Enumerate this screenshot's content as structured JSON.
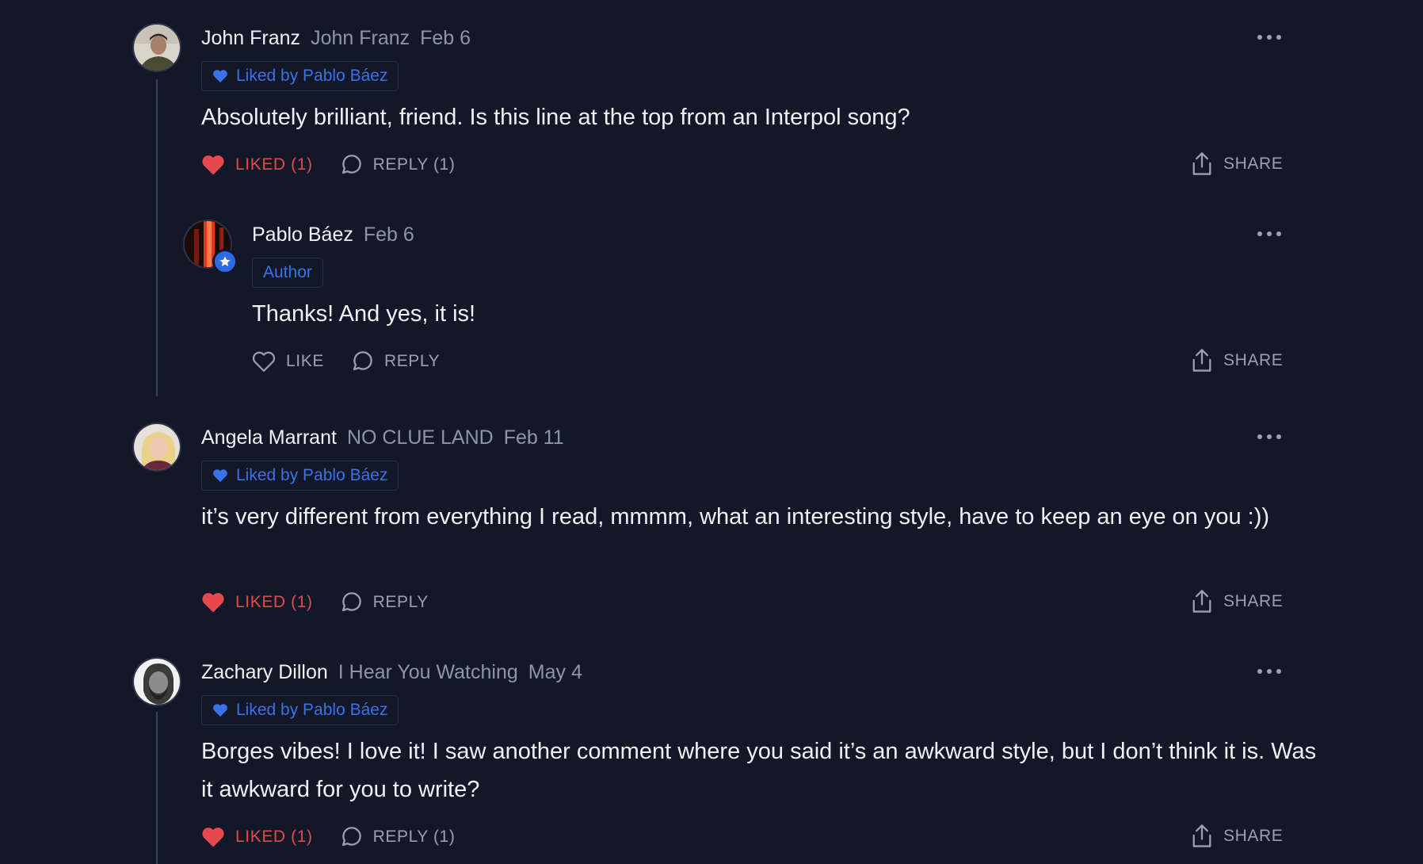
{
  "comments": [
    {
      "name": "John Franz",
      "publication": "John Franz",
      "date": "Feb 6",
      "badge": "Liked by Pablo Báez",
      "text": "Absolutely brilliant, friend. Is this line at the top from an Interpol song?",
      "like_label": "LIKED (1)",
      "reply_label": "REPLY (1)",
      "share_label": "SHARE",
      "liked": true
    },
    {
      "name": "Pablo Báez",
      "date": "Feb 6",
      "badge": "Author",
      "text": "Thanks! And yes, it is!",
      "like_label": "LIKE",
      "reply_label": "REPLY",
      "share_label": "SHARE",
      "liked": false
    },
    {
      "name": "Angela Marrant",
      "publication": "NO CLUE LAND",
      "date": "Feb 11",
      "badge": "Liked by Pablo Báez",
      "text": "it’s very different from everything I read, mmmm, what an interesting style, have to keep an eye on you :))",
      "like_label": "LIKED (1)",
      "reply_label": "REPLY",
      "share_label": "SHARE",
      "liked": true
    },
    {
      "name": "Zachary Dillon",
      "publication": "I Hear You Watching",
      "date": "May 4",
      "badge": "Liked by Pablo Báez",
      "text": "Borges vibes! I love it! I saw another comment where you said it’s an awkward style, but I don’t think it is. Was it awkward for you to write?",
      "like_label": "LIKED (1)",
      "reply_label": "REPLY (1)",
      "share_label": "SHARE",
      "liked": true
    }
  ],
  "colors": {
    "background": "#121827",
    "accent_blue": "#3a72e8",
    "liked_red": "#e5484d",
    "muted": "#9aa1ad"
  },
  "icons": {
    "badge": "heart-filled-icon",
    "author": "star-icon",
    "like": "heart-icon",
    "reply": "speech-bubble-icon",
    "share": "share-upload-icon",
    "more": "ellipsis-icon"
  }
}
